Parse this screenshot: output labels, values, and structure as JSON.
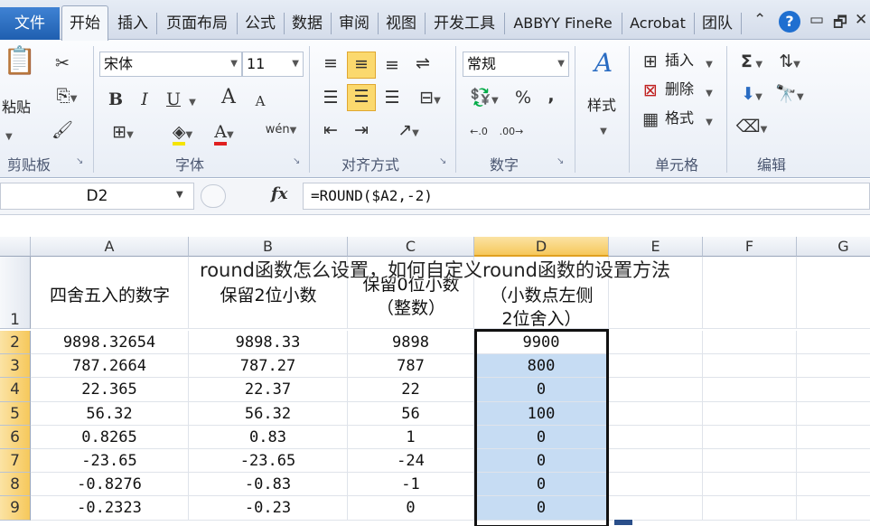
{
  "tabs": [
    "文件",
    "开始",
    "插入",
    "页面布局",
    "公式",
    "数据",
    "审阅",
    "视图",
    "开发工具",
    "ABBYY FineRe",
    "Acrobat",
    "团队"
  ],
  "window_controls": {
    "help": "?",
    "caret": "⌃",
    "minimize": "▭",
    "restore": "🗗",
    "close": "✕"
  },
  "ribbon": {
    "clipboard": {
      "paste_label": "粘贴",
      "group_label": "剪贴板"
    },
    "font": {
      "font_name": "宋体",
      "font_size": "11",
      "bold": "B",
      "italic": "I",
      "underline": "U",
      "grow": "A",
      "shrink": "A",
      "font_color_letter": "A",
      "phonetic": "wén",
      "group_label": "字体"
    },
    "alignment": {
      "group_label": "对齐方式"
    },
    "number": {
      "format": "常规",
      "percent": "%",
      "comma": ",",
      "increase_decimal": ".0→.00",
      "decrease_decimal": ".00→.0",
      "group_label": "数字"
    },
    "styles": {
      "label": "样式"
    },
    "cells": {
      "insert": "插入",
      "delete": "删除",
      "format": "格式",
      "group_label": "单元格"
    },
    "editing": {
      "sum": "Σ",
      "group_label": "编辑"
    }
  },
  "formula_bar": {
    "name_box": "D2",
    "fx": "fx",
    "formula": "=ROUND($A2,-2)"
  },
  "columns": [
    "A",
    "B",
    "C",
    "D",
    "E",
    "F",
    "G"
  ],
  "header_row": {
    "row_number": "1",
    "A": "四舍五入的数字",
    "B": "保留2位小数",
    "C_line1": "保留0位小数",
    "C_line2": "（整数）",
    "D_line1": "（小数点左侧",
    "D_line2": "2位舍入）"
  },
  "rows": [
    {
      "n": "2",
      "A": "9898.32654",
      "B": "9898.33",
      "C": "9898",
      "D": "9900"
    },
    {
      "n": "3",
      "A": "787.2664",
      "B": "787.27",
      "C": "787",
      "D": "800"
    },
    {
      "n": "4",
      "A": "22.365",
      "B": "22.37",
      "C": "22",
      "D": "0"
    },
    {
      "n": "5",
      "A": "56.32",
      "B": "56.32",
      "C": "56",
      "D": "100"
    },
    {
      "n": "6",
      "A": "0.8265",
      "B": "0.83",
      "C": "1",
      "D": "0"
    },
    {
      "n": "7",
      "A": "-23.65",
      "B": "-23.65",
      "C": "-24",
      "D": "0"
    },
    {
      "n": "8",
      "A": "-0.8276",
      "B": "-0.83",
      "C": "-1",
      "D": "0"
    },
    {
      "n": "9",
      "A": "-0.2323",
      "B": "-0.23",
      "C": "0",
      "D": "0"
    }
  ],
  "watermark": "round函数怎么设置，如何自定义round函数的设置方法",
  "colors": {
    "file_tab": "#2a6cc2",
    "selection_fill": "#c6dcf3",
    "selected_header": "#f6c85b",
    "highlight_button": "#fbd96e"
  }
}
